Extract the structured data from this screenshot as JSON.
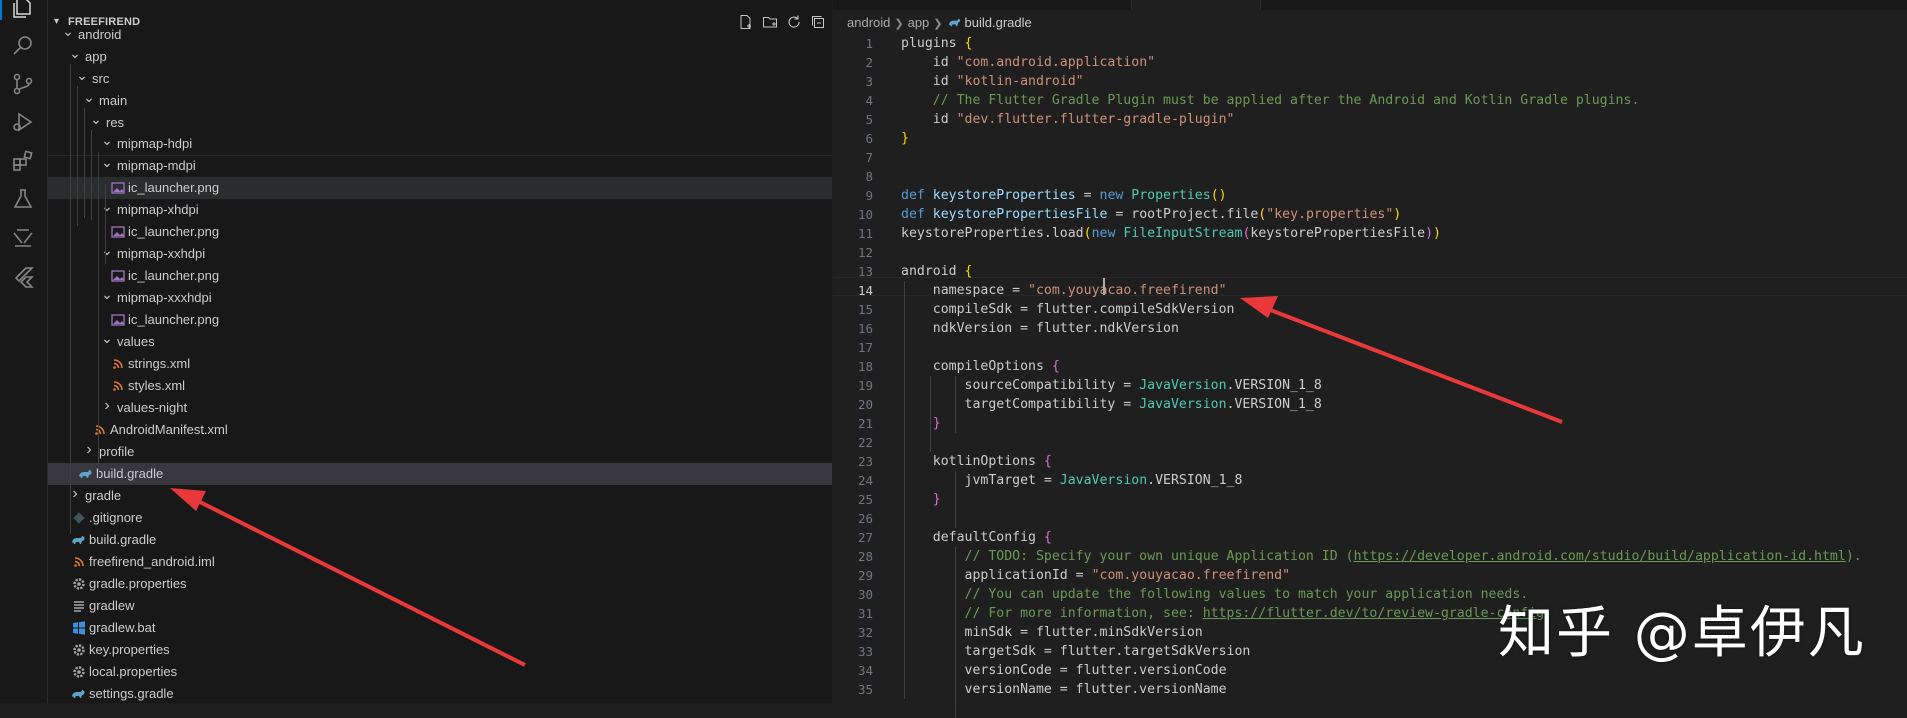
{
  "explorer": {
    "title": "FREEFIREND",
    "actions": [
      "new-file-icon",
      "new-folder-icon",
      "refresh-icon",
      "collapse-all-icon"
    ],
    "items": [
      {
        "label": "android",
        "kind": "folder-open"
      },
      {
        "label": "app",
        "kind": "folder-open"
      },
      {
        "label": "src",
        "kind": "folder-open"
      },
      {
        "label": "main",
        "kind": "folder-open"
      },
      {
        "label": "res",
        "kind": "folder-open"
      },
      {
        "label": "mipmap-hdpi",
        "kind": "folder-open"
      },
      {
        "label": "mipmap-mdpi",
        "kind": "folder-open"
      },
      {
        "label": "ic_launcher.png",
        "kind": "image"
      },
      {
        "label": "mipmap-xhdpi",
        "kind": "folder-open"
      },
      {
        "label": "ic_launcher.png",
        "kind": "image"
      },
      {
        "label": "mipmap-xxhdpi",
        "kind": "folder-open"
      },
      {
        "label": "ic_launcher.png",
        "kind": "image"
      },
      {
        "label": "mipmap-xxxhdpi",
        "kind": "folder-open"
      },
      {
        "label": "ic_launcher.png",
        "kind": "image"
      },
      {
        "label": "values",
        "kind": "folder-open"
      },
      {
        "label": "strings.xml",
        "kind": "xml"
      },
      {
        "label": "styles.xml",
        "kind": "xml"
      },
      {
        "label": "values-night",
        "kind": "folder-closed"
      },
      {
        "label": "AndroidManifest.xml",
        "kind": "xml"
      },
      {
        "label": "profile",
        "kind": "folder-closed"
      },
      {
        "label": "build.gradle",
        "kind": "gradle",
        "selected": true
      },
      {
        "label": "gradle",
        "kind": "folder-closed"
      },
      {
        "label": ".gitignore",
        "kind": "git"
      },
      {
        "label": "build.gradle",
        "kind": "gradle"
      },
      {
        "label": "freefirend_android.iml",
        "kind": "xml"
      },
      {
        "label": "gradle.properties",
        "kind": "gear"
      },
      {
        "label": "gradlew",
        "kind": "lines"
      },
      {
        "label": "gradlew.bat",
        "kind": "windows"
      },
      {
        "label": "key.properties",
        "kind": "gear"
      },
      {
        "label": "local.properties",
        "kind": "gear"
      },
      {
        "label": "settings.gradle",
        "kind": "gradle"
      }
    ]
  },
  "breadcrumb": {
    "parts": [
      "android",
      "app",
      "build.gradle"
    ]
  },
  "editor": {
    "current_line": 14,
    "lines": [
      [
        [
          "plain",
          "plugins "
        ],
        [
          "br1",
          "{"
        ]
      ],
      [
        [
          "plain",
          "    id "
        ],
        [
          "str",
          "\"com.android.application\""
        ]
      ],
      [
        [
          "plain",
          "    id "
        ],
        [
          "str",
          "\"kotlin-android\""
        ]
      ],
      [
        [
          "com",
          "    // The Flutter Gradle Plugin must be applied after the Android and Kotlin Gradle plugins."
        ]
      ],
      [
        [
          "plain",
          "    id "
        ],
        [
          "str",
          "\"dev.flutter.flutter-gradle-plugin\""
        ]
      ],
      [
        [
          "br1",
          "}"
        ]
      ],
      [],
      [],
      [
        [
          "kw",
          "def "
        ],
        [
          "var",
          "keystoreProperties"
        ],
        [
          "plain",
          " = "
        ],
        [
          "kw",
          "new "
        ],
        [
          "ty",
          "Properties"
        ],
        [
          "br1",
          "()"
        ]
      ],
      [
        [
          "kw",
          "def "
        ],
        [
          "var",
          "keystorePropertiesFile"
        ],
        [
          "plain",
          " = rootProject.file"
        ],
        [
          "br1",
          "("
        ],
        [
          "str",
          "\"key.properties\""
        ],
        [
          "br1",
          ")"
        ]
      ],
      [
        [
          "plain",
          "keystoreProperties.load"
        ],
        [
          "br1",
          "("
        ],
        [
          "kw",
          "new "
        ],
        [
          "ty",
          "FileInputStream"
        ],
        [
          "br2",
          "("
        ],
        [
          "plain",
          "keystorePropertiesFile"
        ],
        [
          "br2",
          ")"
        ],
        [
          "br1",
          ")"
        ]
      ],
      [],
      [
        [
          "plain",
          "android "
        ],
        [
          "br1",
          "{"
        ]
      ],
      [
        [
          "plain",
          "    namespace = "
        ],
        [
          "str",
          "\"com.youyacao.freefirend\""
        ]
      ],
      [
        [
          "plain",
          "    compileSdk = flutter.compileSdkVersion"
        ]
      ],
      [
        [
          "plain",
          "    ndkVersion = flutter.ndkVersion"
        ]
      ],
      [],
      [
        [
          "plain",
          "    compileOptions "
        ],
        [
          "br2",
          "{"
        ]
      ],
      [
        [
          "plain",
          "        sourceCompatibility = "
        ],
        [
          "ty",
          "JavaVersion"
        ],
        [
          "plain",
          ".VERSION_1_8"
        ]
      ],
      [
        [
          "plain",
          "        targetCompatibility = "
        ],
        [
          "ty",
          "JavaVersion"
        ],
        [
          "plain",
          ".VERSION_1_8"
        ]
      ],
      [
        [
          "br2",
          "    }"
        ]
      ],
      [],
      [
        [
          "plain",
          "    kotlinOptions "
        ],
        [
          "br2",
          "{"
        ]
      ],
      [
        [
          "plain",
          "        jvmTarget = "
        ],
        [
          "ty",
          "JavaVersion"
        ],
        [
          "plain",
          ".VERSION_1_8"
        ]
      ],
      [
        [
          "br2",
          "    }"
        ]
      ],
      [],
      [
        [
          "plain",
          "    defaultConfig "
        ],
        [
          "br2",
          "{"
        ]
      ],
      [
        [
          "com",
          "        // TODO: Specify your own unique Application ID ("
        ],
        [
          "link",
          "https://developer.android.com/studio/build/application-id.html"
        ],
        [
          "com",
          ")."
        ]
      ],
      [
        [
          "plain",
          "        applicationId = "
        ],
        [
          "str",
          "\"com.youyacao.freefirend\""
        ]
      ],
      [
        [
          "com",
          "        // You can update the following values to match your application needs."
        ]
      ],
      [
        [
          "com",
          "        // For more information, see: "
        ],
        [
          "link",
          "https://flutter.dev/to/review-gradle-config"
        ]
      ],
      [
        [
          "plain",
          "        minSdk = flutter.minSdkVersion"
        ]
      ],
      [
        [
          "plain",
          "        targetSdk = flutter.targetSdkVersion"
        ]
      ],
      [
        [
          "plain",
          "        versionCode = flutter.versionCode"
        ]
      ],
      [
        [
          "plain",
          "        versionName = flutter.versionName"
        ]
      ]
    ]
  },
  "watermark": "知乎 @卓伊凡",
  "colors": {
    "arrow": "#e8383a",
    "selection": "#37373d",
    "accent": "#0078d4"
  }
}
